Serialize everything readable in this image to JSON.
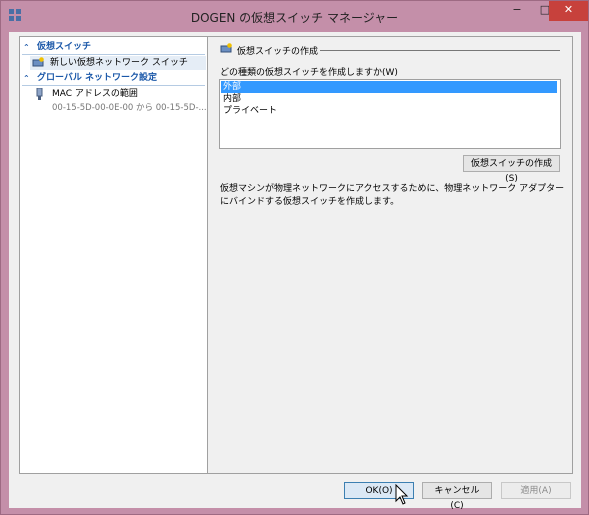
{
  "window": {
    "title": "DOGEN の仮想スイッチ マネージャー",
    "controls": {
      "minimize": "−",
      "maximize": "□",
      "close": "✕"
    }
  },
  "sidebar": {
    "group1": {
      "label": "仮想スイッチ"
    },
    "item1": {
      "label": "新しい仮想ネットワーク スイッチ"
    },
    "group2": {
      "label": "グローバル ネットワーク設定"
    },
    "item2": {
      "label": "MAC アドレスの範囲",
      "sub": "00-15-5D-00-0E-00 から 00-15-5D-..."
    }
  },
  "main": {
    "section_title": "仮想スイッチの作成",
    "prompt": "どの種類の仮想スイッチを作成しますか(W)",
    "options": [
      "外部",
      "内部",
      "プライベート"
    ],
    "selected_index": 0,
    "create_button": "仮想スイッチの作成(S)",
    "description": "仮想マシンが物理ネットワークにアクセスするために、物理ネットワーク アダプターにバインドする仮想スイッチを作成します。"
  },
  "footer": {
    "ok": "OK(O)",
    "cancel": "キャンセル(C)",
    "apply": "適用(A)"
  }
}
